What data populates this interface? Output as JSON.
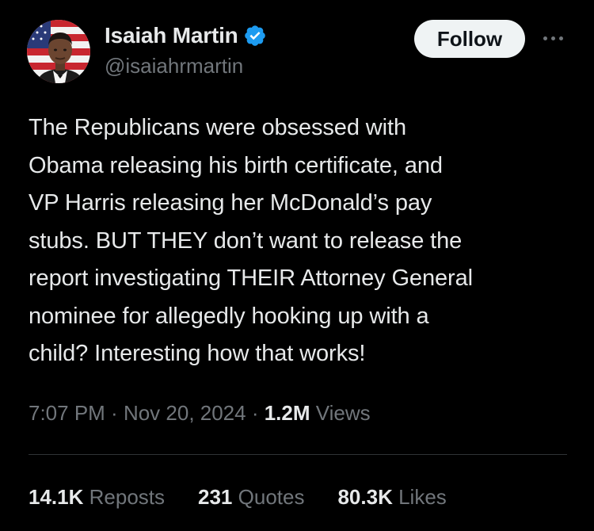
{
  "author": {
    "display_name": "Isaiah Martin",
    "handle": "@isaiahrmartin",
    "verified": true,
    "verified_color": "#1d9bf0"
  },
  "follow_label": "Follow",
  "tweet_text": "The Republicans were obsessed with\nObama releasing his birth certificate, and\nVP Harris releasing her McDonald’s pay\nstubs. BUT THEY don’t want to release the\nreport investigating THEIR Attorney General\nnominee for allegedly hooking up with a\nchild? Interesting how that works!",
  "meta": {
    "time": "7:07 PM",
    "separator": " · ",
    "date": "Nov 20, 2024",
    "views_count": "1.2M",
    "views_label": "Views"
  },
  "stats": {
    "reposts": {
      "count": "14.1K",
      "label": "Reposts"
    },
    "quotes": {
      "count": "231",
      "label": "Quotes"
    },
    "likes": {
      "count": "80.3K",
      "label": "Likes"
    }
  },
  "colors": {
    "background": "#000000",
    "text_primary": "#e7e9ea",
    "text_secondary": "#71767b",
    "divider": "#2f3336",
    "follow_bg": "#eff3f4"
  },
  "icons": {
    "verified": "verified-badge-icon",
    "more": "more-horizontal-icon"
  }
}
